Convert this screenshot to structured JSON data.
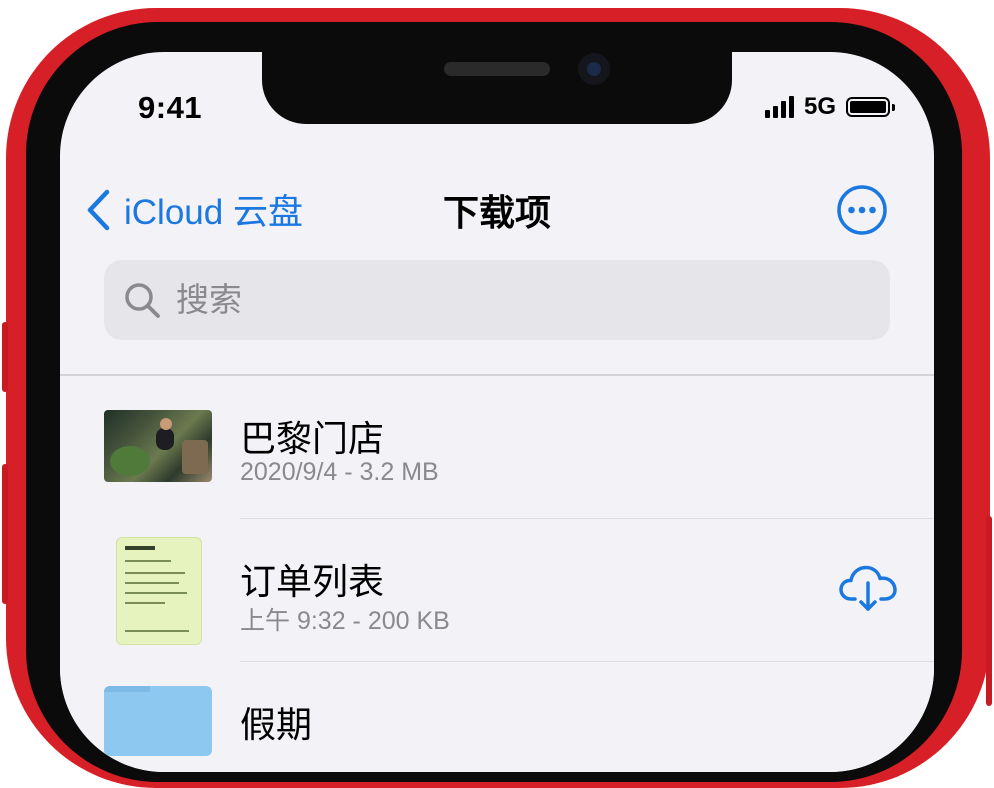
{
  "status_bar": {
    "time": "9:41",
    "network": "5G"
  },
  "nav": {
    "back_label": "iCloud 云盘",
    "title": "下载项",
    "more_icon": "ellipsis-circle-icon"
  },
  "search": {
    "placeholder": "搜索"
  },
  "files": [
    {
      "name": "巴黎门店",
      "meta": "2020/9/4 - 3.2 MB",
      "thumbnail": "photo"
    },
    {
      "name": "订单列表",
      "meta": "上午 9:32 - 200 KB",
      "thumbnail": "document",
      "action_icon": "icloud-download-icon"
    },
    {
      "name": "假期",
      "thumbnail": "folder"
    }
  ],
  "colors": {
    "accent": "#1b78e0",
    "frame": "#d61f26",
    "background": "#f2f2f7",
    "secondary_text": "#8a8a8e"
  }
}
